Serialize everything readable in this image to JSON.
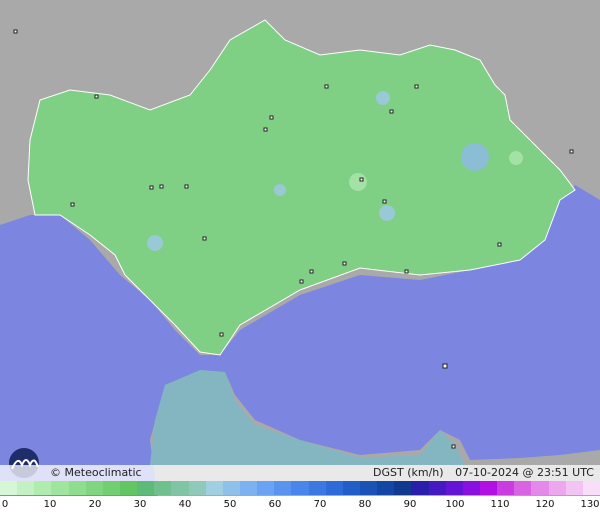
{
  "map": {
    "credit": "© Meteoclimatic",
    "variable_label": "DGST (km/h)",
    "timestamp": "07-10-2024 @ 23:51 UTC",
    "colors": {
      "sea": "#7c86e0",
      "land_outside": "#a9a9a9",
      "region": "#7fcf84"
    }
  },
  "legend": {
    "unit": "km/h",
    "ticks": [
      "0",
      "10",
      "20",
      "30",
      "40",
      "50",
      "60",
      "70",
      "80",
      "90",
      "100",
      "110",
      "120",
      "130"
    ],
    "colors": [
      "#d6f7d6",
      "#c3f1c3",
      "#b0ebb0",
      "#9fe59f",
      "#8fde8f",
      "#80d680",
      "#71ce71",
      "#62c662",
      "#5dba79",
      "#6fbf8f",
      "#7fc4a4",
      "#8fc9b9",
      "#9fcfe0",
      "#8fc0ea",
      "#7cb2f0",
      "#6aa3f2",
      "#5a94ee",
      "#4a86ea",
      "#3b78e2",
      "#2d6bd8",
      "#225ec8",
      "#1a52b6",
      "#1446a3",
      "#103a8e",
      "#2a1fa8",
      "#4519c2",
      "#6514d6",
      "#8a10e2",
      "#b10fe6",
      "#c83ce0",
      "#d864e4",
      "#e488ea",
      "#eca7ef",
      "#f2c4f4",
      "#f8def8"
    ]
  }
}
